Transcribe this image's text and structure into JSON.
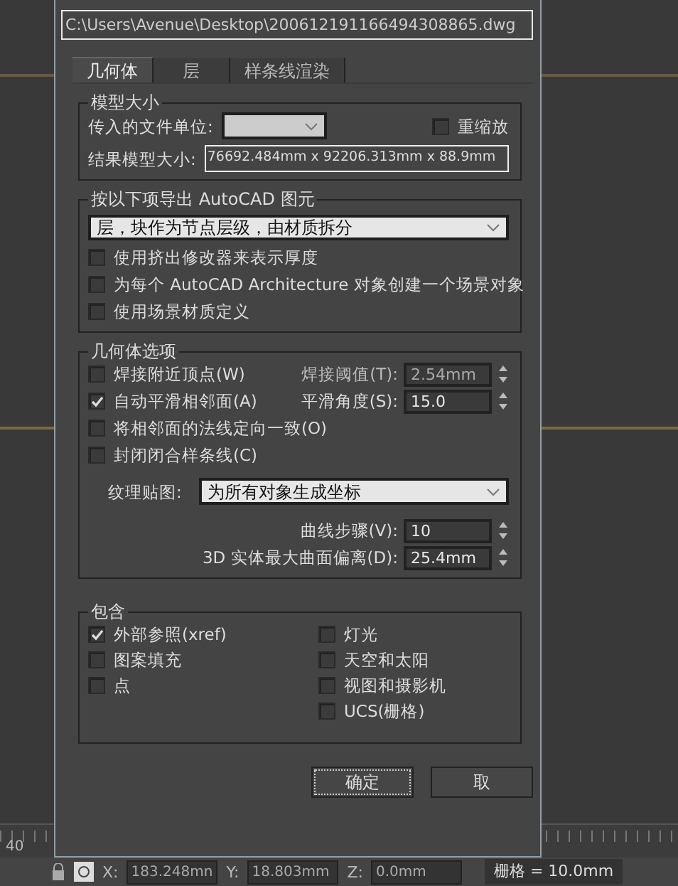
{
  "dialog": {
    "path_field": {
      "value": "C:\\Users\\Avenue\\Desktop\\200612191166494308865.dwg"
    }
  },
  "tabs": [
    {
      "label": "几何体",
      "selected": true
    },
    {
      "label": "层",
      "selected": false
    },
    {
      "label": "样条线渲染",
      "selected": false
    }
  ],
  "model_size": {
    "title": "模型大小",
    "unit_label": "传入的文件单位:",
    "unit_select": {
      "disabled": true
    },
    "rescale": {
      "label": "重缩放",
      "checked": false
    },
    "result_label": "结果模型大小:",
    "result_value": "76692.484mm x 92206.313mm x 88.9mm"
  },
  "export": {
    "title": "按以下项导出 AutoCAD 图元",
    "select": {
      "value": "层，块作为节点层级，由材质拆分"
    },
    "options": [
      {
        "label": "使用挤出修改器来表示厚度",
        "checked": false
      },
      {
        "label": "为每个 AutoCAD Architecture 对象创建一个场景对象",
        "checked": false
      },
      {
        "label": "使用场景材质定义",
        "checked": false
      }
    ]
  },
  "geometry": {
    "title": "几何体选项",
    "options": [
      {
        "label": "焊接附近顶点(W)",
        "checked": false,
        "spinner": {
          "label": "焊接阈值(T):",
          "value": "2.54mm",
          "disabled": true
        }
      },
      {
        "label": "自动平滑相邻面(A)",
        "checked": true,
        "spinner": {
          "label": "平滑角度(S):",
          "value": "15.0",
          "disabled": false
        }
      },
      {
        "label": "将相邻面的法线定向一致(O)",
        "checked": false
      },
      {
        "label": "封闭闭合样条线(C)",
        "checked": false
      }
    ],
    "texture": {
      "label": "纹理贴图:",
      "value": "为所有对象生成坐标"
    },
    "spinners": [
      {
        "label": "曲线步骤(V):",
        "value": "10",
        "disabled": false
      },
      {
        "label": "3D 实体最大曲面偏离(D):",
        "value": "25.4mm",
        "disabled": false
      }
    ]
  },
  "include": {
    "title": "包含",
    "left": [
      {
        "label": "外部参照(xref)",
        "checked": true
      },
      {
        "label": "图案填充",
        "checked": false
      },
      {
        "label": "点",
        "checked": false
      }
    ],
    "right": [
      {
        "label": "灯光",
        "checked": false
      },
      {
        "label": "天空和太阳",
        "checked": false
      },
      {
        "label": "视图和摄影机",
        "checked": false
      },
      {
        "label": "UCS(栅格)",
        "checked": false
      }
    ]
  },
  "buttons": [
    {
      "label": "确定",
      "focused": true
    },
    {
      "label": "取",
      "focused": false
    }
  ],
  "viewport": {
    "ruler_label": "40"
  },
  "status_bar": {
    "coords": [
      {
        "label": "X:",
        "value": "183.248mn"
      },
      {
        "label": "Y:",
        "value": "18.803mm"
      },
      {
        "label": "Z:",
        "value": "0.0mm"
      }
    ],
    "grid": "栅格 = 10.0mm"
  }
}
